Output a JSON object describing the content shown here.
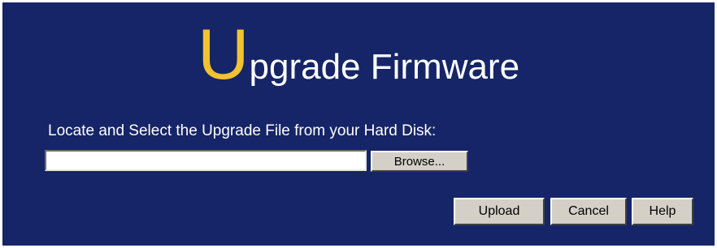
{
  "page": {
    "title_initial": "U",
    "title_rest": "pgrade Firmware",
    "instruction": "Locate and Select the Upgrade File from your Hard Disk:"
  },
  "file_input": {
    "value": ""
  },
  "buttons": {
    "browse": "Browse...",
    "upload": "Upload",
    "cancel": "Cancel",
    "help": "Help"
  },
  "colors": {
    "panel_background": "#162567",
    "title_initial": "#f2c230",
    "text": "#ffffff",
    "button_face": "#d4d0c8"
  }
}
